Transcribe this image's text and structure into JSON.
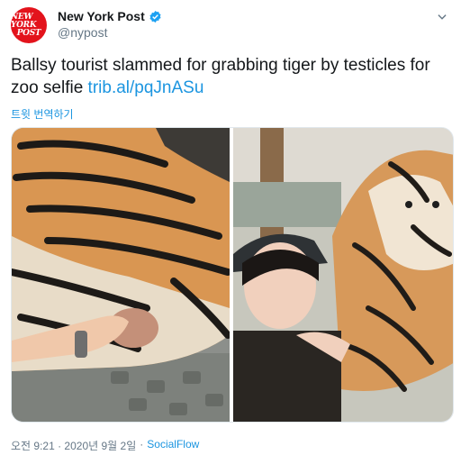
{
  "account": {
    "name": "New York Post",
    "handle": "@nypost",
    "avatar_line1": "NEW YORK",
    "avatar_line2": "POST"
  },
  "tweet": {
    "text": "Ballsy tourist slammed for grabbing tiger by testicles for zoo selfie ",
    "link": "trib.al/pqJnASu",
    "translate_label": "트윗 번역하기"
  },
  "meta": {
    "timestamp": "오전 9:21 · 2020년 9월 2일",
    "separator": "·",
    "source": "SocialFlow"
  },
  "icons": {
    "verified": "verified-badge-icon",
    "caret": "chevron-down-icon"
  },
  "colors": {
    "brand_red": "#e3131c",
    "link_blue": "#1b95e0",
    "muted": "#657786"
  }
}
